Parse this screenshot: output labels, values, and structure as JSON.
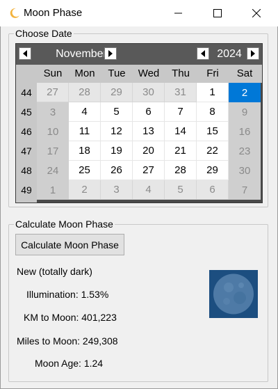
{
  "window": {
    "title": "Moon Phase"
  },
  "date_group": {
    "label": "Choose Date"
  },
  "calendar": {
    "month": "November",
    "year": "2024",
    "weekdays": [
      "Sun",
      "Mon",
      "Tue",
      "Wed",
      "Thu",
      "Fri",
      "Sat"
    ],
    "weeks": [
      {
        "num": "44",
        "days": [
          "27",
          "28",
          "29",
          "30",
          "31",
          "1",
          "2"
        ]
      },
      {
        "num": "45",
        "days": [
          "3",
          "4",
          "5",
          "6",
          "7",
          "8",
          "9"
        ]
      },
      {
        "num": "46",
        "days": [
          "10",
          "11",
          "12",
          "13",
          "14",
          "15",
          "16"
        ]
      },
      {
        "num": "47",
        "days": [
          "17",
          "18",
          "19",
          "20",
          "21",
          "22",
          "23"
        ]
      },
      {
        "num": "48",
        "days": [
          "24",
          "25",
          "26",
          "27",
          "28",
          "29",
          "30"
        ]
      },
      {
        "num": "49",
        "days": [
          "1",
          "2",
          "3",
          "4",
          "5",
          "6",
          "7"
        ]
      }
    ],
    "selected_day": "2",
    "colors": {
      "header": "#595959",
      "selected": "#0078d7",
      "weekend": "#cfcfcf"
    }
  },
  "calc_group": {
    "label": "Calculate Moon Phase",
    "button_label": "Calculate Moon Phase",
    "phase_name": "New (totally dark)",
    "illumination": "Illumination: 1.53%",
    "km_to_moon": "KM to Moon: 401,223",
    "miles_to_moon": "Miles to Moon: 249,308",
    "moon_age": "Moon Age: 1.24"
  },
  "icons": {
    "app": "moon-crescent-icon",
    "minimize": "minimize-icon",
    "maximize": "maximize-icon",
    "close": "close-icon",
    "prev": "chevron-left-icon",
    "next": "chevron-right-icon"
  }
}
